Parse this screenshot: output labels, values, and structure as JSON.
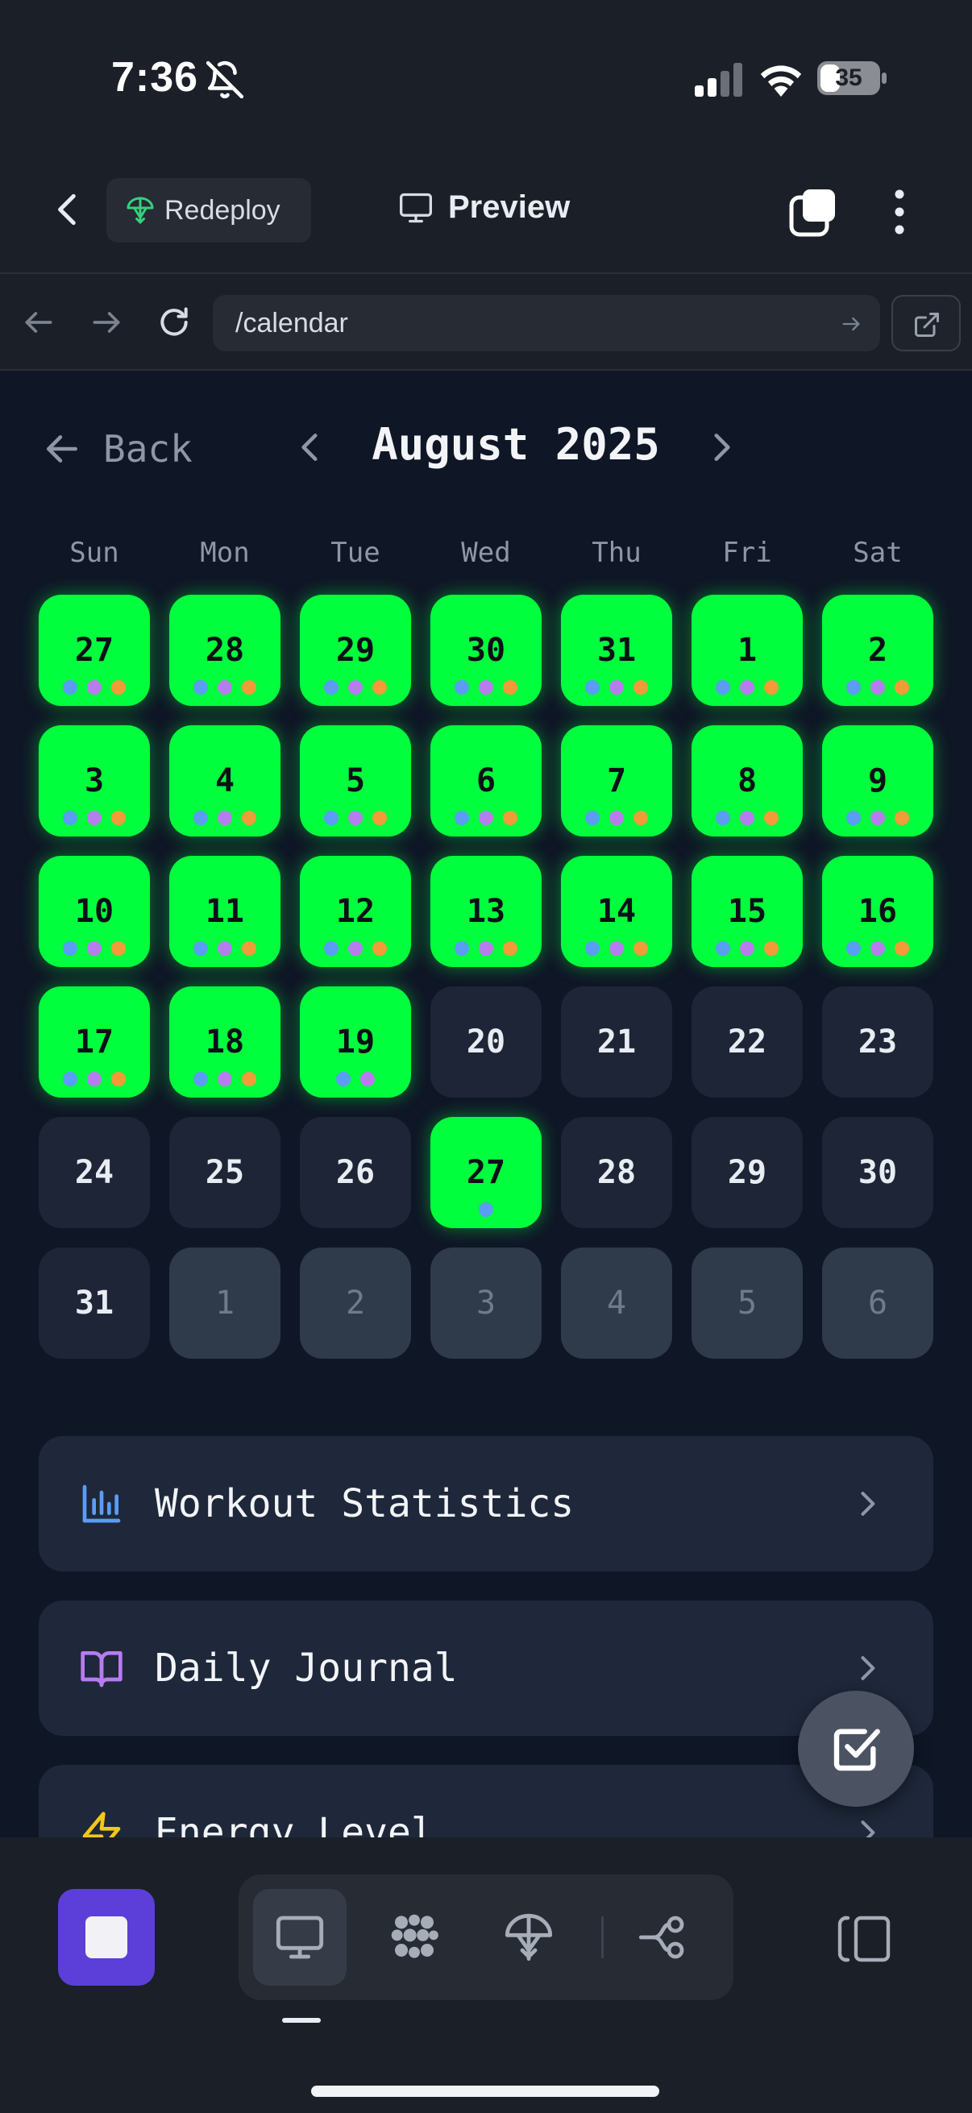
{
  "status_bar": {
    "time": "7:36",
    "battery": "35"
  },
  "header": {
    "redeploy_label": "Redeploy",
    "preview_label": "Preview"
  },
  "browser": {
    "url": "/calendar"
  },
  "calendar": {
    "back_label": "Back",
    "month_title": "August 2025",
    "weekdays": [
      "Sun",
      "Mon",
      "Tue",
      "Wed",
      "Thu",
      "Fri",
      "Sat"
    ],
    "dot_colors": {
      "blue": "#5b9cf5",
      "purple": "#b77cf0",
      "orange": "#f29b38"
    },
    "active_color": "#00ff3c",
    "days": [
      {
        "label": "27",
        "state": "active",
        "dots": [
          "blue",
          "purple",
          "orange"
        ]
      },
      {
        "label": "28",
        "state": "active",
        "dots": [
          "blue",
          "purple",
          "orange"
        ]
      },
      {
        "label": "29",
        "state": "active",
        "dots": [
          "blue",
          "purple",
          "orange"
        ]
      },
      {
        "label": "30",
        "state": "active",
        "dots": [
          "blue",
          "purple",
          "orange"
        ]
      },
      {
        "label": "31",
        "state": "active",
        "dots": [
          "blue",
          "purple",
          "orange"
        ]
      },
      {
        "label": "1",
        "state": "active",
        "dots": [
          "blue",
          "purple",
          "orange"
        ]
      },
      {
        "label": "2",
        "state": "active",
        "dots": [
          "blue",
          "purple",
          "orange"
        ]
      },
      {
        "label": "3",
        "state": "active",
        "dots": [
          "blue",
          "purple",
          "orange"
        ]
      },
      {
        "label": "4",
        "state": "active",
        "dots": [
          "blue",
          "purple",
          "orange"
        ]
      },
      {
        "label": "5",
        "state": "active",
        "dots": [
          "blue",
          "purple",
          "orange"
        ]
      },
      {
        "label": "6",
        "state": "active",
        "dots": [
          "blue",
          "purple",
          "orange"
        ]
      },
      {
        "label": "7",
        "state": "active",
        "dots": [
          "blue",
          "purple",
          "orange"
        ]
      },
      {
        "label": "8",
        "state": "active",
        "dots": [
          "blue",
          "purple",
          "orange"
        ]
      },
      {
        "label": "9",
        "state": "active",
        "dots": [
          "blue",
          "purple",
          "orange"
        ]
      },
      {
        "label": "10",
        "state": "active",
        "dots": [
          "blue",
          "purple",
          "orange"
        ]
      },
      {
        "label": "11",
        "state": "active",
        "dots": [
          "blue",
          "purple",
          "orange"
        ]
      },
      {
        "label": "12",
        "state": "active",
        "dots": [
          "blue",
          "purple",
          "orange"
        ]
      },
      {
        "label": "13",
        "state": "active",
        "dots": [
          "blue",
          "purple",
          "orange"
        ]
      },
      {
        "label": "14",
        "state": "active",
        "dots": [
          "blue",
          "purple",
          "orange"
        ]
      },
      {
        "label": "15",
        "state": "active",
        "dots": [
          "blue",
          "purple",
          "orange"
        ]
      },
      {
        "label": "16",
        "state": "active",
        "dots": [
          "blue",
          "purple",
          "orange"
        ]
      },
      {
        "label": "17",
        "state": "active",
        "dots": [
          "blue",
          "purple",
          "orange"
        ]
      },
      {
        "label": "18",
        "state": "active",
        "dots": [
          "blue",
          "purple",
          "orange"
        ]
      },
      {
        "label": "19",
        "state": "active",
        "dots": [
          "blue",
          "purple"
        ]
      },
      {
        "label": "20",
        "state": "empty",
        "dots": []
      },
      {
        "label": "21",
        "state": "empty",
        "dots": []
      },
      {
        "label": "22",
        "state": "empty",
        "dots": []
      },
      {
        "label": "23",
        "state": "empty",
        "dots": []
      },
      {
        "label": "24",
        "state": "empty",
        "dots": []
      },
      {
        "label": "25",
        "state": "empty",
        "dots": []
      },
      {
        "label": "26",
        "state": "empty",
        "dots": []
      },
      {
        "label": "27",
        "state": "active",
        "dots": [
          "blue"
        ]
      },
      {
        "label": "28",
        "state": "empty",
        "dots": []
      },
      {
        "label": "29",
        "state": "empty",
        "dots": []
      },
      {
        "label": "30",
        "state": "empty",
        "dots": []
      },
      {
        "label": "31",
        "state": "empty",
        "dots": []
      },
      {
        "label": "1",
        "state": "out",
        "dots": []
      },
      {
        "label": "2",
        "state": "out",
        "dots": []
      },
      {
        "label": "3",
        "state": "out",
        "dots": []
      },
      {
        "label": "4",
        "state": "out",
        "dots": []
      },
      {
        "label": "5",
        "state": "out",
        "dots": []
      },
      {
        "label": "6",
        "state": "out",
        "dots": []
      }
    ]
  },
  "cards": {
    "workout_statistics": "Workout Statistics",
    "daily_journal": "Daily Journal",
    "energy_level": "Energy Level"
  },
  "icons": {
    "statistics": "bar-chart-icon",
    "journal": "open-book-icon",
    "energy": "lightning-icon",
    "fab": "checkbox-icon"
  }
}
